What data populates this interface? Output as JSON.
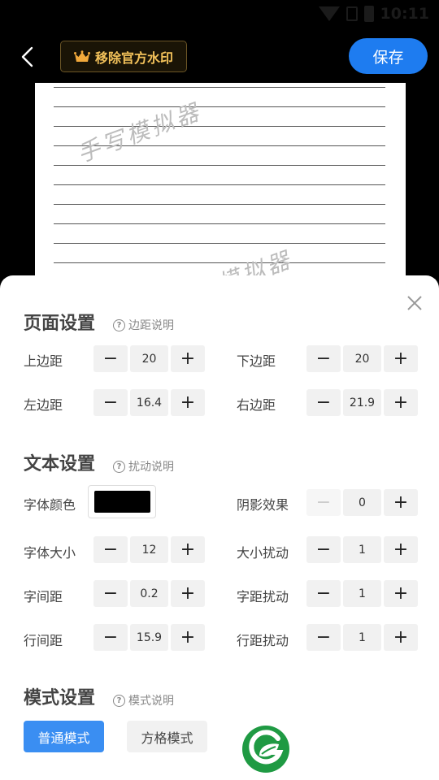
{
  "status_bar": {
    "time": "10:11"
  },
  "header": {
    "watermark_label": "移除官方水印",
    "save_label": "保存"
  },
  "preview": {
    "watermark_text": "手写模拟器"
  },
  "page_settings": {
    "title": "页面设置",
    "help": "边距说明",
    "top_margin": {
      "label": "上边距",
      "value": "20"
    },
    "bottom_margin": {
      "label": "下边距",
      "value": "20"
    },
    "left_margin": {
      "label": "左边距",
      "value": "16.4"
    },
    "right_margin": {
      "label": "右边距",
      "value": "21.9"
    }
  },
  "text_settings": {
    "title": "文本设置",
    "help": "扰动说明",
    "font_color": {
      "label": "字体颜色",
      "value": "#000000"
    },
    "shadow": {
      "label": "阴影效果",
      "value": "0"
    },
    "font_size": {
      "label": "字体大小",
      "value": "12"
    },
    "size_jitter": {
      "label": "大小扰动",
      "value": "1"
    },
    "letter_spacing": {
      "label": "字间距",
      "value": "0.2"
    },
    "spacing_jitter": {
      "label": "字距扰动",
      "value": "1"
    },
    "line_spacing": {
      "label": "行间距",
      "value": "15.9"
    },
    "line_jitter": {
      "label": "行距扰动",
      "value": "1"
    }
  },
  "mode_settings": {
    "title": "模式设置",
    "help": "模式说明",
    "normal": "普通模式",
    "grid": "方格模式"
  },
  "stepper_symbols": {
    "minus": "−",
    "plus": "+"
  },
  "help_symbol": "?",
  "colors": {
    "accent": "#1e7cf0",
    "mode_active": "#3a8ef2",
    "watermark_text": "#f2c15a",
    "logo_green": "#1f9a43"
  },
  "icons": [
    "back-arrow-icon",
    "crown-icon",
    "close-icon",
    "help-circle-icon",
    "app-logo-icon"
  ]
}
